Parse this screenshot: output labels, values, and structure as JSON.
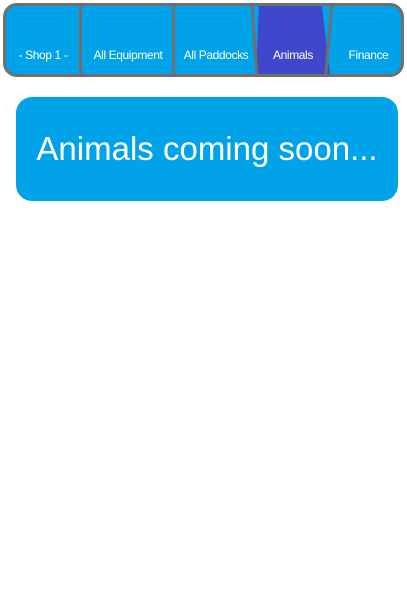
{
  "colors": {
    "tab_bg": "#00a2e8",
    "tab_active_bg": "#3f48cc",
    "border": "#6f6f6f",
    "text": "#ffffff",
    "page_bg": "#ffffff"
  },
  "tabs": [
    {
      "label": "- Shop 1 -",
      "active": false
    },
    {
      "label": "All Equipment",
      "active": false
    },
    {
      "label": "All Paddocks",
      "active": false
    },
    {
      "label": "Animals",
      "active": true
    },
    {
      "label": "Finance",
      "active": false
    }
  ],
  "main": {
    "message": "Animals coming soon..."
  }
}
